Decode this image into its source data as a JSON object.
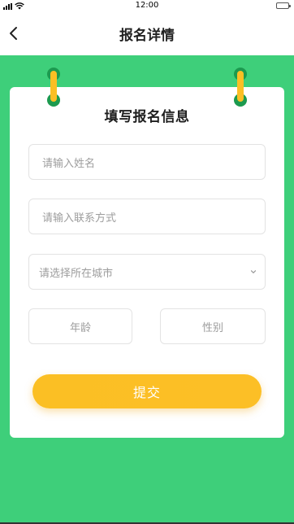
{
  "status_bar": {
    "time": "12:00"
  },
  "nav": {
    "title": "报名详情"
  },
  "form": {
    "title": "填写报名信息",
    "name": {
      "placeholder": "请输入姓名",
      "value": ""
    },
    "contact": {
      "placeholder": "请输入联系方式",
      "value": ""
    },
    "city": {
      "selected": "请选择所在城市"
    },
    "age": {
      "placeholder": "年龄",
      "value": ""
    },
    "gender": {
      "placeholder": "性别",
      "value": ""
    },
    "submit_label": "提交"
  },
  "colors": {
    "background_green": "#3ecf7a",
    "ring_green": "#1d9a4f",
    "accent_yellow": "#fbbf24",
    "card_white": "#ffffff"
  },
  "icons": {
    "back": "chevron-left-icon",
    "dropdown": "chevron-down-icon",
    "signal": "cellular-signal-icon",
    "wifi": "wifi-icon",
    "battery": "battery-icon"
  }
}
